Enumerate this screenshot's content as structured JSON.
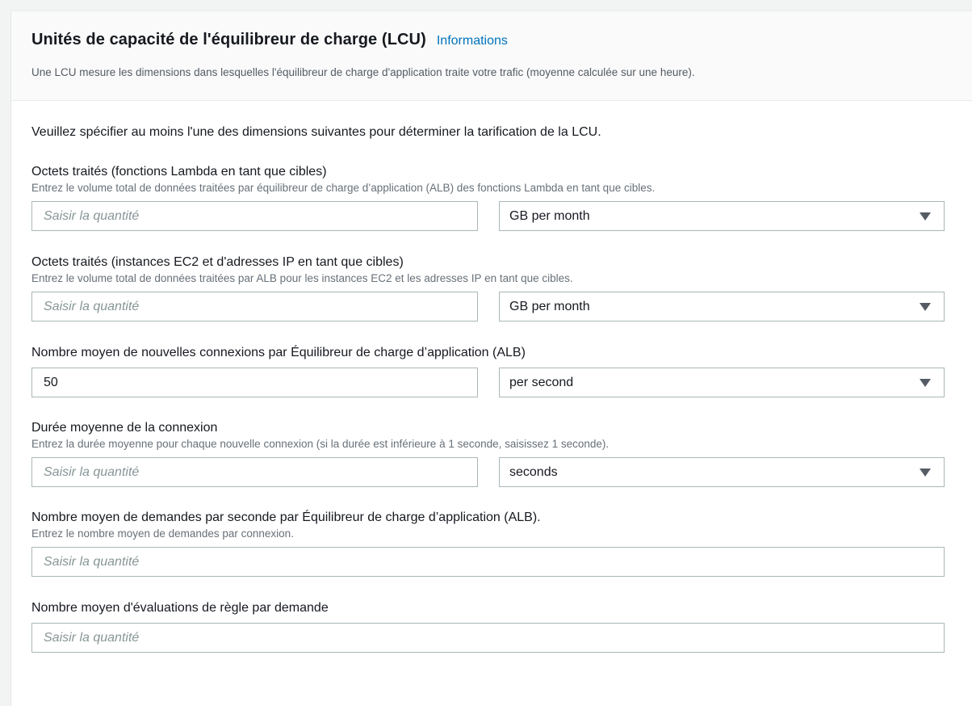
{
  "header": {
    "title": "Unités de capacité de l'équilibreur de charge (LCU)",
    "info_link": "Informations",
    "description": "Une LCU mesure les dimensions dans lesquelles l'équilibreur de charge d'application traite votre trafic (moyenne calculée sur une heure)."
  },
  "intro": "Veuillez spécifier au moins l'une des dimensions suivantes pour déterminer la tarification de la LCU.",
  "fields": [
    {
      "label": "Octets traités (fonctions Lambda en tant que cibles)",
      "description": "Entrez le volume total de données traitées par équilibreur de charge d’application (ALB) des fonctions Lambda en tant que cibles.",
      "placeholder": "Saisir la quantité",
      "value": "",
      "unit": "GB per month"
    },
    {
      "label": "Octets traités (instances EC2 et d'adresses IP en tant que cibles)",
      "description": "Entrez le volume total de données traitées par ALB pour les instances EC2 et les adresses IP en tant que cibles.",
      "placeholder": "Saisir la quantité",
      "value": "",
      "unit": "GB per month"
    },
    {
      "label": "Nombre moyen de nouvelles connexions par Équilibreur de charge d’application (ALB)",
      "description": "",
      "placeholder": "Saisir la quantité",
      "value": "50",
      "unit": "per second"
    },
    {
      "label": "Durée moyenne de la connexion",
      "description": "Entrez la durée moyenne pour chaque nouvelle connexion (si la durée est inférieure à 1 seconde, saisissez 1 seconde).",
      "placeholder": "Saisir la quantité",
      "value": "",
      "unit": "seconds"
    },
    {
      "label": "Nombre moyen de demandes par seconde par Équilibreur de charge d’application (ALB).",
      "description": "Entrez le nombre moyen de demandes par connexion.",
      "placeholder": "Saisir la quantité",
      "value": ""
    },
    {
      "label": "Nombre moyen d'évaluations de règle par demande",
      "description": "",
      "placeholder": "Saisir la quantité",
      "value": ""
    }
  ],
  "colors": {
    "link": "#0073bb",
    "border": "#aab7b8",
    "placeholder": "#879596"
  }
}
